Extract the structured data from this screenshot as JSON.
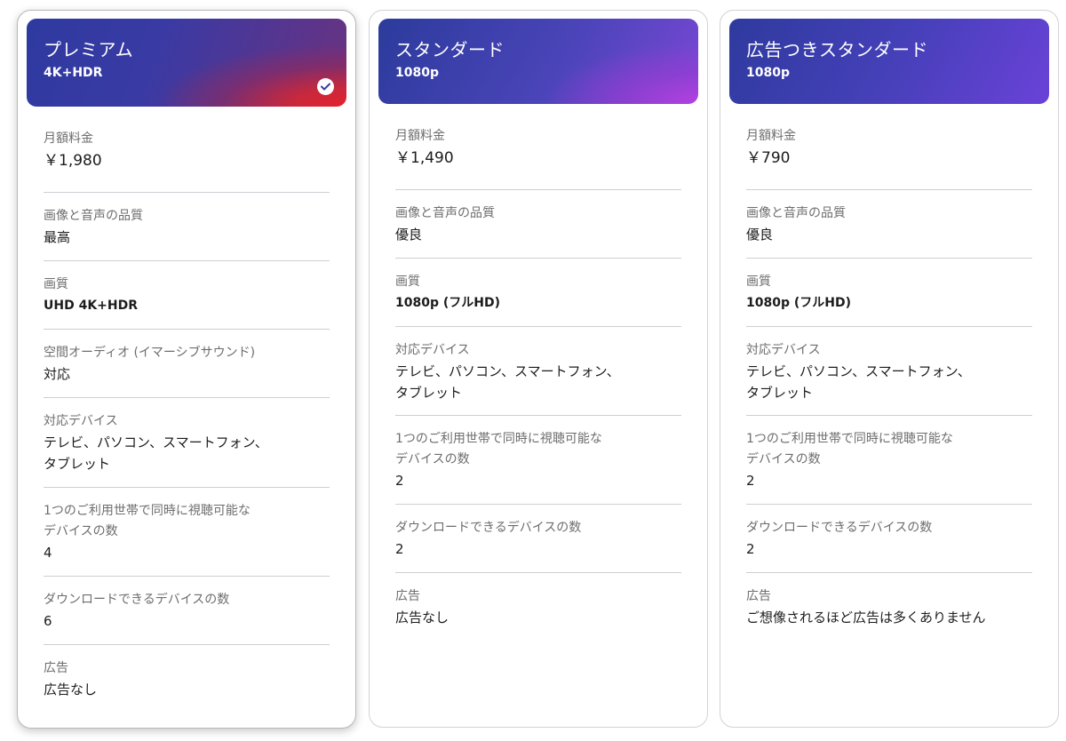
{
  "plans": [
    {
      "name": "プレミアム",
      "resolution": "4K+HDR",
      "selected": true,
      "rows": [
        {
          "label": "月額料金",
          "value": "￥1,980"
        },
        {
          "label": "画像と音声の品質",
          "value": "最高"
        },
        {
          "label": "画質",
          "value": "UHD 4K+HDR"
        },
        {
          "label": "空間オーディオ (イマーシブサウンド)",
          "value": "対応"
        },
        {
          "label": "対応デバイス",
          "value": "テレビ、パソコン、スマートフォン、\nタブレット"
        },
        {
          "label": "1つのご利用世帯で同時に視聴可能な\nデバイスの数",
          "value": "4"
        },
        {
          "label": "ダウンロードできるデバイスの数",
          "value": "6"
        },
        {
          "label": "広告",
          "value": "広告なし"
        }
      ]
    },
    {
      "name": "スタンダード",
      "resolution": "1080p",
      "selected": false,
      "rows": [
        {
          "label": "月額料金",
          "value": "￥1,490"
        },
        {
          "label": "画像と音声の品質",
          "value": "優良"
        },
        {
          "label": "画質",
          "value": "1080p (フルHD)"
        },
        {
          "label": "対応デバイス",
          "value": "テレビ、パソコン、スマートフォン、\nタブレット"
        },
        {
          "label": "1つのご利用世帯で同時に視聴可能な\nデバイスの数",
          "value": "2"
        },
        {
          "label": "ダウンロードできるデバイスの数",
          "value": "2"
        },
        {
          "label": "広告",
          "value": "広告なし"
        }
      ]
    },
    {
      "name": "広告つきスタンダード",
      "resolution": "1080p",
      "selected": false,
      "rows": [
        {
          "label": "月額料金",
          "value": "￥790"
        },
        {
          "label": "画像と音声の品質",
          "value": "優良"
        },
        {
          "label": "画質",
          "value": "1080p (フルHD)"
        },
        {
          "label": "対応デバイス",
          "value": "テレビ、パソコン、スマートフォン、\nタブレット"
        },
        {
          "label": "1つのご利用世帯で同時に視聴可能な\nデバイスの数",
          "value": "2"
        },
        {
          "label": "ダウンロードできるデバイスの数",
          "value": "2"
        },
        {
          "label": "広告",
          "value": "ご想像されるほど広告は多くありません"
        }
      ]
    }
  ],
  "icons": {
    "selected": "check-circle-icon"
  },
  "colors": {
    "check": "#3a3aa4",
    "divider": "#cfcfd4",
    "label": "#6d6d6d"
  }
}
